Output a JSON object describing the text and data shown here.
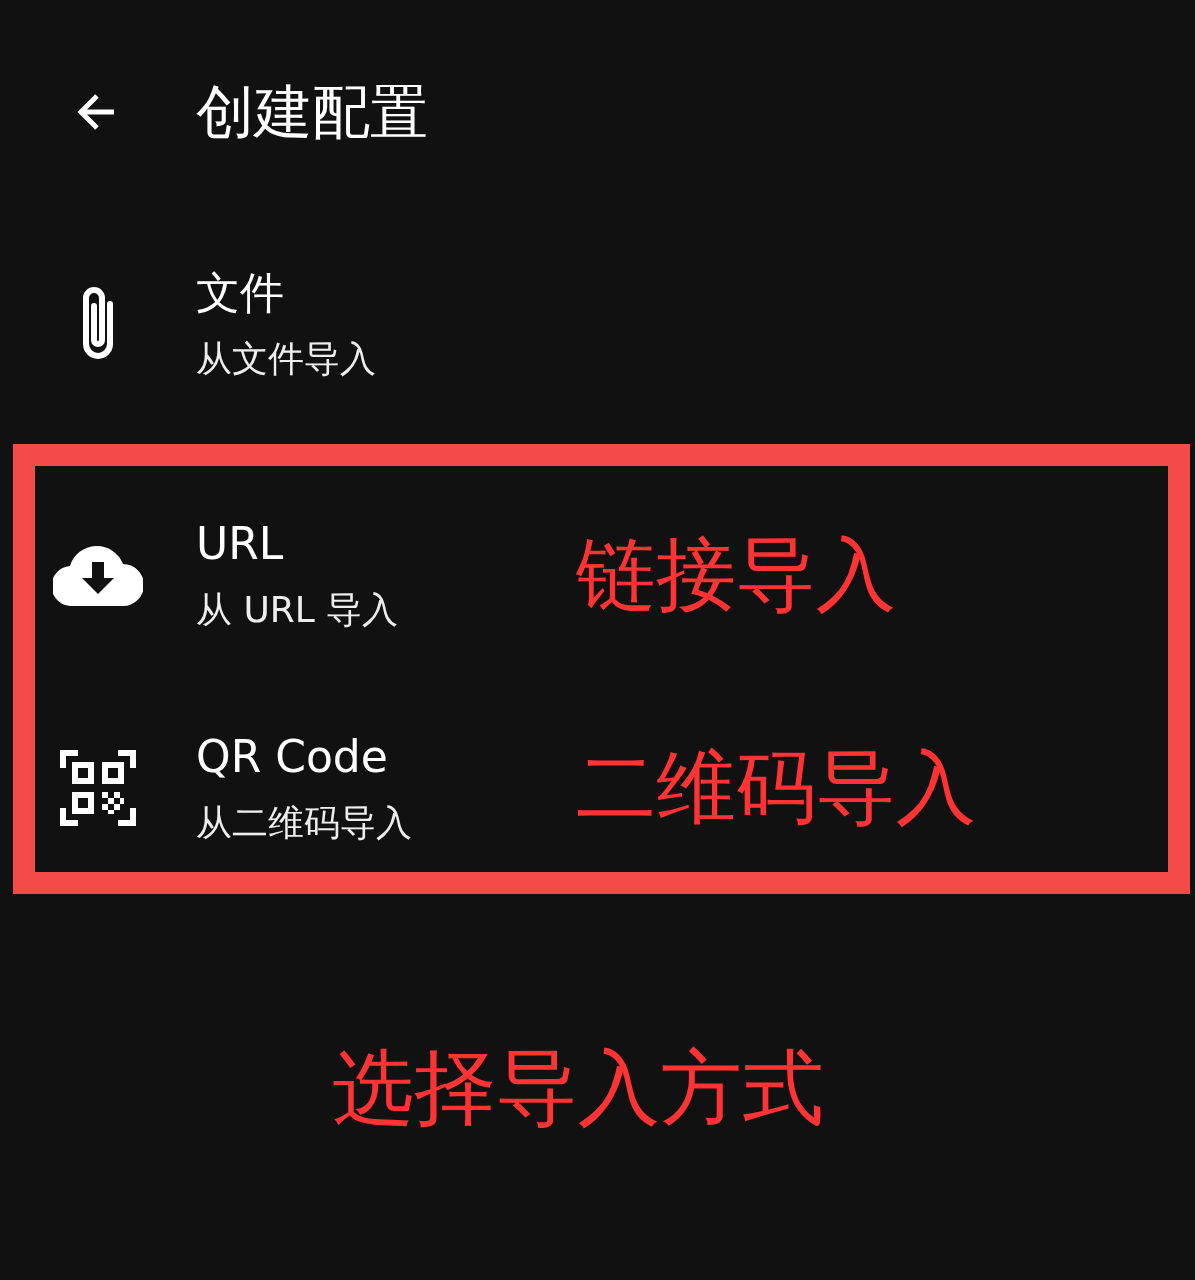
{
  "app_bar": {
    "title": "创建配置"
  },
  "items": [
    {
      "kind": "file",
      "title": "文件",
      "subtitle": "从文件导入"
    }
  ],
  "highlight_box": {
    "items": [
      {
        "kind": "url",
        "title": "URL",
        "subtitle": "从 URL 导入",
        "note": "链接导入"
      },
      {
        "kind": "qr",
        "title": "QR Code",
        "subtitle": "从二维码导入",
        "note": "二维码导入"
      }
    ]
  },
  "caption": "选择导入方式"
}
